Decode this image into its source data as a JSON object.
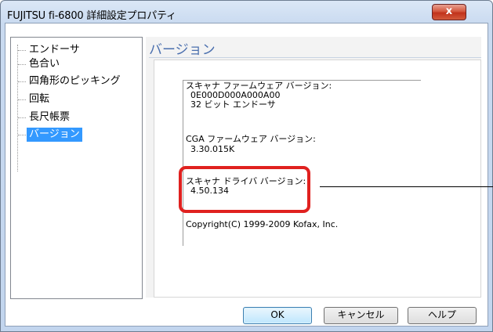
{
  "window": {
    "title": "FUJITSU fi-6800 詳細設定プロパティ",
    "close_label": "x"
  },
  "tree": {
    "items": [
      {
        "label": "エンドーサ",
        "selected": false
      },
      {
        "label": "色合い",
        "selected": false
      },
      {
        "label": "四角形のピッキング",
        "selected": false
      },
      {
        "label": "回転",
        "selected": false
      },
      {
        "label": "長尺帳票",
        "selected": false
      },
      {
        "label": "バージョン",
        "selected": true
      }
    ]
  },
  "panel": {
    "title": "バージョン",
    "firmware_label": "スキャナ ファームウェア バージョン:",
    "firmware_value": "0E000D000A000A00",
    "endorser_value": "32 ビット エンドーサ",
    "cga_label": "CGA ファームウェア バージョン:",
    "cga_value": "3.30.015K",
    "driver_label": "スキャナ ドライバ バージョン:",
    "driver_value": "4.50.134",
    "copyright": "Copyright(C) 1999-2009 Kofax, Inc."
  },
  "buttons": {
    "ok": "OK",
    "cancel": "キャンセル",
    "help": "ヘルプ"
  },
  "colors": {
    "highlight": "#e0211f",
    "selection": "#3399ff",
    "panel_title": "#4a6fae"
  }
}
